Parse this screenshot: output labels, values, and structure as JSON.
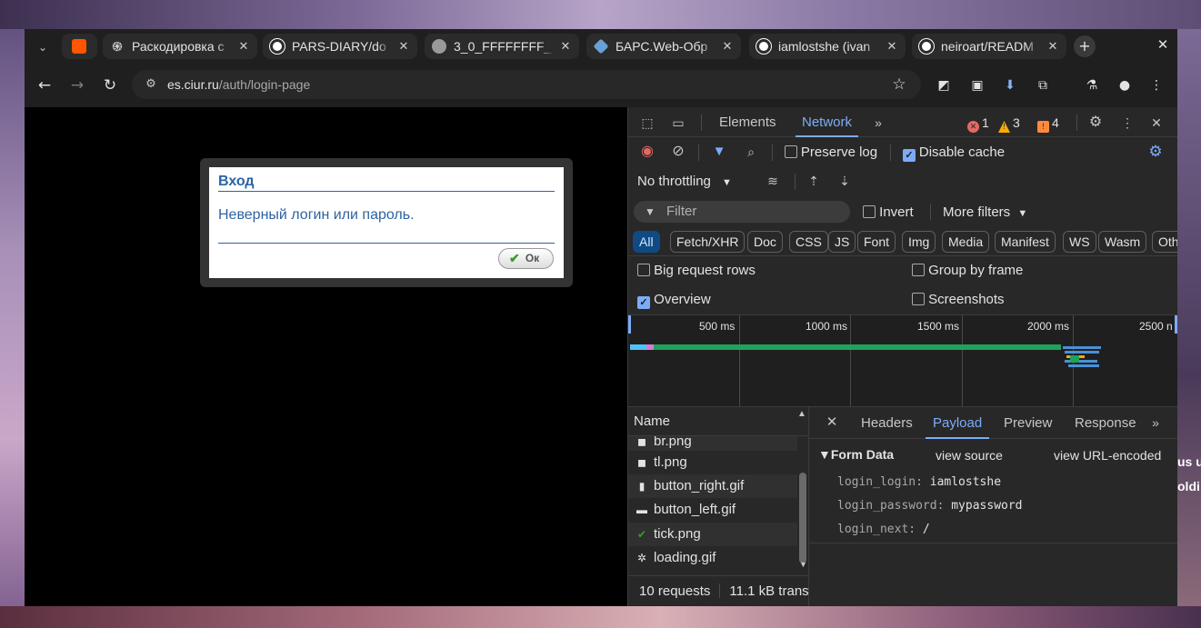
{
  "browser": {
    "tabs": [
      {
        "title": "",
        "favicon_color": "#ff5500",
        "icon": "soundcloud-icon"
      },
      {
        "title": "Раскодировка с",
        "favicon_color": "#ffffff",
        "icon": "openai-icon"
      },
      {
        "title": "PARS-DIARY/do",
        "favicon_color": "#ffffff",
        "icon": "github-icon"
      },
      {
        "title": "3_0_FFFFFFFF_",
        "favicon_color": "#9a9a9a",
        "icon": "globe-icon"
      },
      {
        "title": "БАРС.Web-Обр",
        "favicon_color": "#6aa0d8",
        "icon": "bars-icon"
      },
      {
        "title": "iamlostshe (ivan",
        "favicon_color": "#ffffff",
        "icon": "github-icon"
      },
      {
        "title": "neiroart/READM",
        "favicon_color": "#ffffff",
        "icon": "github-icon"
      }
    ],
    "url_host": "es.ciur.ru",
    "url_path": "/auth/login-page"
  },
  "page": {
    "dialog": {
      "title": "Вход",
      "message": "Неверный логин или пароль.",
      "ok_label": "Ок"
    }
  },
  "devtools": {
    "tabs": {
      "elements": "Elements",
      "network": "Network"
    },
    "counts": {
      "errors": "1",
      "warnings": "3",
      "issues": "4"
    },
    "toolbar": {
      "preserve_log": "Preserve log",
      "disable_cache": "Disable cache",
      "throttling": "No throttling"
    },
    "filter": {
      "placeholder": "Filter",
      "invert": "Invert",
      "more_filters": "More filters"
    },
    "type_chips": [
      "All",
      "Fetch/XHR",
      "Doc",
      "CSS",
      "JS",
      "Font",
      "Img",
      "Media",
      "Manifest",
      "WS",
      "Wasm",
      "Oth"
    ],
    "options": {
      "big_rows": "Big request rows",
      "group_by_frame": "Group by frame",
      "overview": "Overview",
      "screenshots": "Screenshots"
    },
    "timeline": {
      "labels": [
        "500 ms",
        "1000 ms",
        "1500 ms",
        "2000 ms",
        "2500 n"
      ]
    },
    "requests": {
      "header": "Name",
      "items": [
        "br.png",
        "tl.png",
        "button_right.gif",
        "button_left.gif",
        "tick.png",
        "loading.gif"
      ],
      "footer_count": "10 requests",
      "footer_transfer": "11.1 kB transf"
    },
    "detail": {
      "tabs": [
        "Headers",
        "Payload",
        "Preview",
        "Response"
      ],
      "section": "▼Form Data",
      "view_source": "view source",
      "view_url_encoded": "view URL-encoded",
      "fields": [
        {
          "key": "login_login:",
          "value": "iamlostshe"
        },
        {
          "key": "login_password:",
          "value": "mypassword"
        },
        {
          "key": "login_next:",
          "value": "/"
        }
      ]
    }
  },
  "background": {
    "peek_line1": "us u",
    "peek_line2": "oldi"
  },
  "colors": {
    "accent": "#7cacf8",
    "dialog_blue": "#2e63a2",
    "error": "#e46962",
    "warning": "#f9ab00",
    "issue": "#ff8a3c"
  }
}
